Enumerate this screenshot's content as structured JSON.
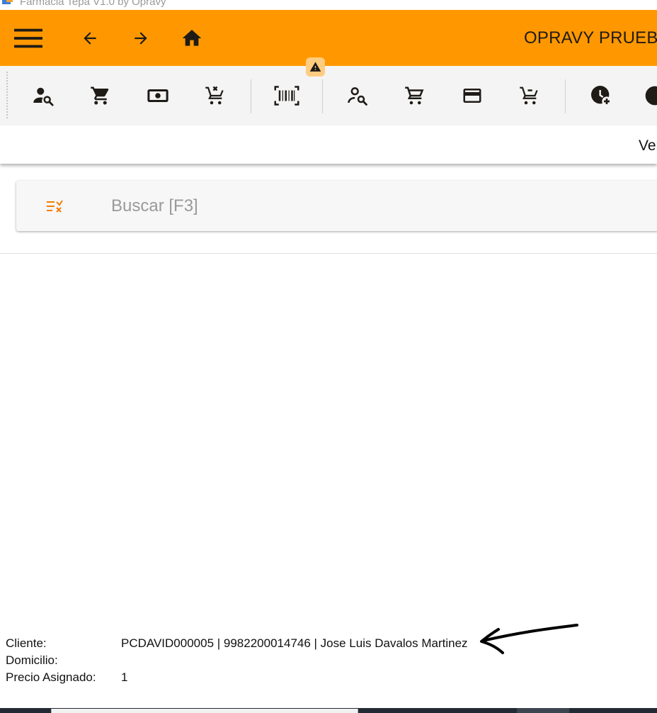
{
  "window": {
    "title": "Farmacia Tepa V1.0 by Opravy"
  },
  "appbar": {
    "company": "OPRAVY PRUEBA",
    "menu_icon": "hamburger-icon",
    "back_icon": "arrow-left-icon",
    "forward_icon": "arrow-right-icon",
    "home_icon": "home-icon",
    "background_color": "#ff9800"
  },
  "toolbar": {
    "groups": [
      [
        "customer-search-icon",
        "cart-icon",
        "cash-icon",
        "cart-remove-icon"
      ],
      [
        "barcode-scan-icon"
      ],
      [
        "customer-search-outline-icon",
        "cart-outline-icon",
        "credit-card-icon",
        "cart-remove-outline-icon"
      ],
      [
        "clock-plus-icon",
        "clock-icon"
      ]
    ],
    "warning_icon": "warning-icon"
  },
  "subbar": {
    "label": "Ventas"
  },
  "search": {
    "placeholder": "Buscar [F3]",
    "filter_icon": "filter-remove-icon",
    "accent_color": "#f57c00"
  },
  "info": {
    "cliente_label": "Cliente:",
    "cliente_value": "PCDAVID000005 | 9982200014746 | Jose Luis Davalos Martinez",
    "domicilio_label": "Domicilio:",
    "domicilio_value": "",
    "precio_label": "Precio Asignado:",
    "precio_value": "1"
  },
  "annotation": {
    "arrow_icon": "hand-drawn-arrow-icon"
  }
}
